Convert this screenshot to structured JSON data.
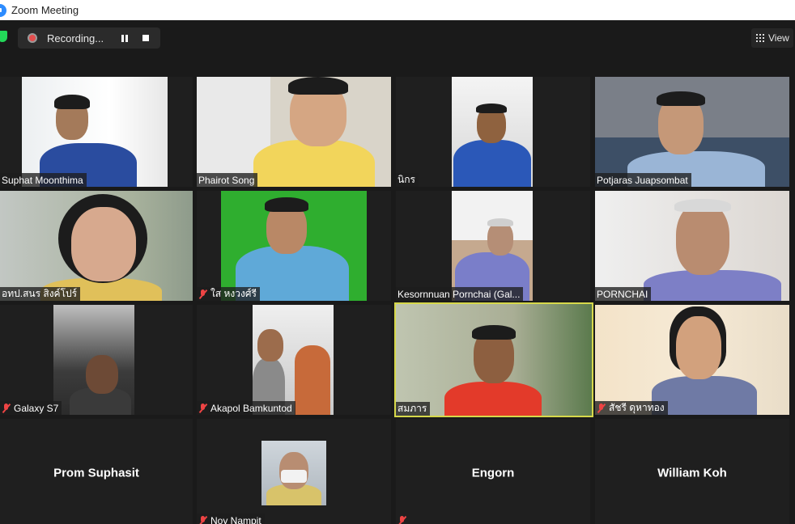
{
  "window": {
    "title": "Zoom Meeting"
  },
  "recording": {
    "label": "Recording..."
  },
  "view_button": {
    "label": "View"
  },
  "colors": {
    "active_speaker_border": "#d6d84a",
    "mute_icon": "#e44444",
    "recording_shield": "#23d959"
  },
  "participants": [
    {
      "name": "Suphat Moonthima",
      "muted": false
    },
    {
      "name": "Phairot Song",
      "muted": false
    },
    {
      "name": "นิกร",
      "muted": false
    },
    {
      "name": "Potjaras Juapsombat",
      "muted": false
    },
    {
      "name": "อทป.สนร สิงค์โปร์",
      "muted": false
    },
    {
      "name": "ใส หงวงศ์รี",
      "muted": true
    },
    {
      "name": "Kesornnuan Pornchai (Gal...",
      "muted": false
    },
    {
      "name": "PORNCHAI",
      "muted": false
    },
    {
      "name": "Galaxy S7",
      "muted": true
    },
    {
      "name": "Akapol Bamkuntod",
      "muted": true
    },
    {
      "name": "สมภาร",
      "muted": false,
      "active_speaker": true
    },
    {
      "name": "สัชรี ดุหาทอง",
      "muted": true
    },
    {
      "name": "Prom Suphasit",
      "video_off": true
    },
    {
      "name": "Noy Nampit",
      "muted": true
    },
    {
      "name": "Engorn",
      "video_off": true,
      "muted": true
    },
    {
      "name": "William Koh",
      "video_off": true
    }
  ]
}
